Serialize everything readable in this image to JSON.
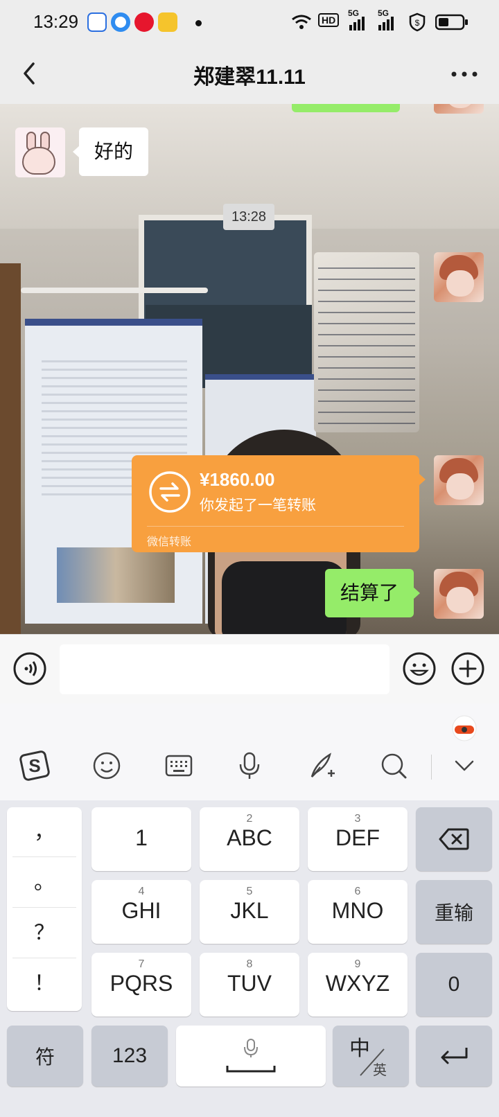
{
  "status_bar": {
    "time": "13:29",
    "network_1": "5G",
    "network_2": "5G",
    "hd": "HD"
  },
  "header": {
    "title": "郑建翠11.11"
  },
  "chat": {
    "messages": [
      {
        "side": "left",
        "type": "text",
        "text": "好的"
      },
      {
        "type": "timestamp",
        "text": "13:28"
      },
      {
        "side": "right",
        "type": "image"
      },
      {
        "side": "right",
        "type": "transfer",
        "amount": "¥1860.00",
        "description": "你发起了一笔转账",
        "footer": "微信转账"
      },
      {
        "side": "right",
        "type": "text",
        "text": "结算了"
      }
    ],
    "colors": {
      "sent_bubble": "#95ec69",
      "received_bubble": "#ffffff",
      "transfer": "#f8a03f"
    }
  },
  "keyboard": {
    "punctuation": [
      "，",
      "。",
      "？",
      "！"
    ],
    "row1": [
      {
        "num": "",
        "label": "1"
      },
      {
        "num": "2",
        "label": "ABC"
      },
      {
        "num": "3",
        "label": "DEF"
      }
    ],
    "row2": [
      {
        "num": "4",
        "label": "GHI"
      },
      {
        "num": "5",
        "label": "JKL"
      },
      {
        "num": "6",
        "label": "MNO"
      }
    ],
    "row3": [
      {
        "num": "7",
        "label": "PQRS"
      },
      {
        "num": "8",
        "label": "TUV"
      },
      {
        "num": "9",
        "label": "WXYZ"
      }
    ],
    "retype": "重输",
    "zero": "0",
    "symbols": "符",
    "num_switch": "123",
    "lang_zh": "中",
    "lang_en": "英",
    "toolbar_icons": [
      "sogou-logo-icon",
      "emoji-icon",
      "keyboard-icon",
      "microphone-icon",
      "handwriting-icon",
      "search-icon",
      "collapse-icon"
    ]
  }
}
